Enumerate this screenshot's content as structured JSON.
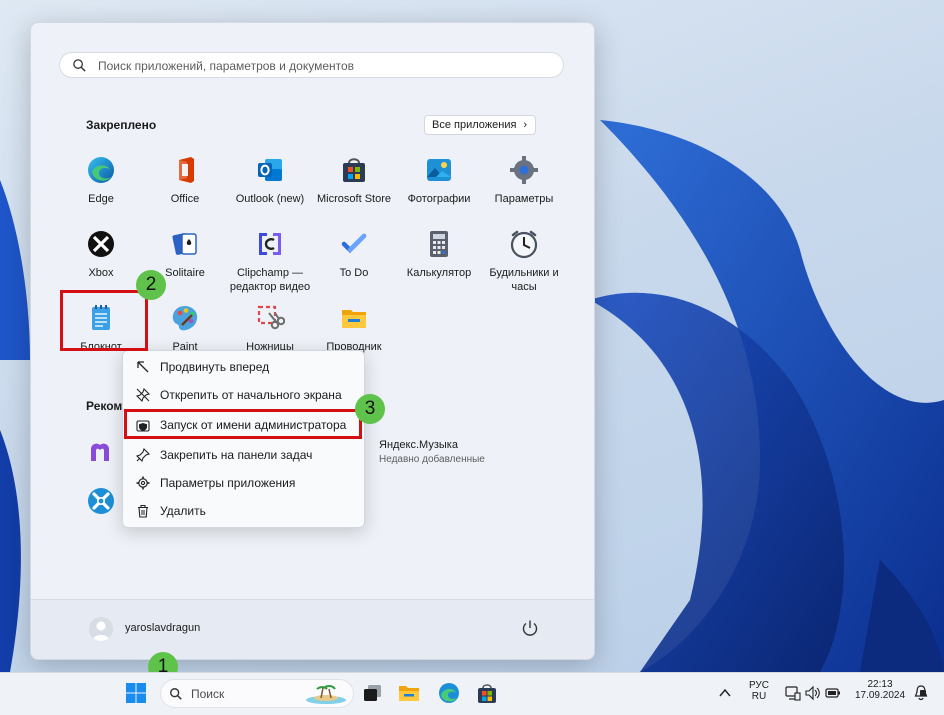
{
  "start_menu": {
    "search_placeholder": "Поиск приложений, параметров и документов",
    "pinned_title": "Закреплено",
    "all_apps_label": "Все приложения",
    "pinned_apps": [
      {
        "label": "Edge",
        "icon": "edge-icon"
      },
      {
        "label": "Office",
        "icon": "office-icon"
      },
      {
        "label": "Outlook (new)",
        "icon": "outlook-icon"
      },
      {
        "label": "Microsoft Store",
        "icon": "store-icon"
      },
      {
        "label": "Фотографии",
        "icon": "photos-icon"
      },
      {
        "label": "Параметры",
        "icon": "settings-icon"
      },
      {
        "label": "Xbox",
        "icon": "xbox-icon"
      },
      {
        "label": "Solitaire",
        "icon": "solitaire-icon"
      },
      {
        "label": "Clipchamp — редактор видео",
        "icon": "clipchamp-icon"
      },
      {
        "label": "To Do",
        "icon": "todo-icon"
      },
      {
        "label": "Калькулятор",
        "icon": "calculator-icon"
      },
      {
        "label": "Будильники и часы",
        "icon": "clock-icon"
      },
      {
        "label": "Блокнот",
        "icon": "notepad-icon"
      },
      {
        "label": "Paint",
        "icon": "paint-icon"
      },
      {
        "label": "Ножницы",
        "icon": "snipping-icon"
      },
      {
        "label": "Проводник",
        "icon": "explorer-icon"
      }
    ],
    "recommended_title": "Реком",
    "recommended": [
      {
        "name": "Яндекс.Музыка",
        "sub": "Недавно добавленные"
      }
    ],
    "username": "yaroslavdragun"
  },
  "context_menu": {
    "items": [
      {
        "label": "Продвинуть вперед",
        "icon": "arrow-up-left-icon"
      },
      {
        "label": "Открепить от начального экрана",
        "icon": "unpin-icon"
      },
      {
        "label": "Запуск от имени администратора",
        "icon": "shield-icon"
      },
      {
        "label": "Закрепить на панели задач",
        "icon": "pin-icon"
      },
      {
        "label": "Параметры приложения",
        "icon": "gear-icon"
      },
      {
        "label": "Удалить",
        "icon": "trash-icon"
      }
    ]
  },
  "annotations": {
    "step1": "1",
    "step2": "2",
    "step3": "3",
    "highlight_color": "#d40f14",
    "badge_color": "#5fc24a"
  },
  "taskbar": {
    "search_placeholder": "Поиск",
    "lang_top": "РУС",
    "lang_bottom": "RU",
    "time": "22:13",
    "date": "17.09.2024"
  }
}
